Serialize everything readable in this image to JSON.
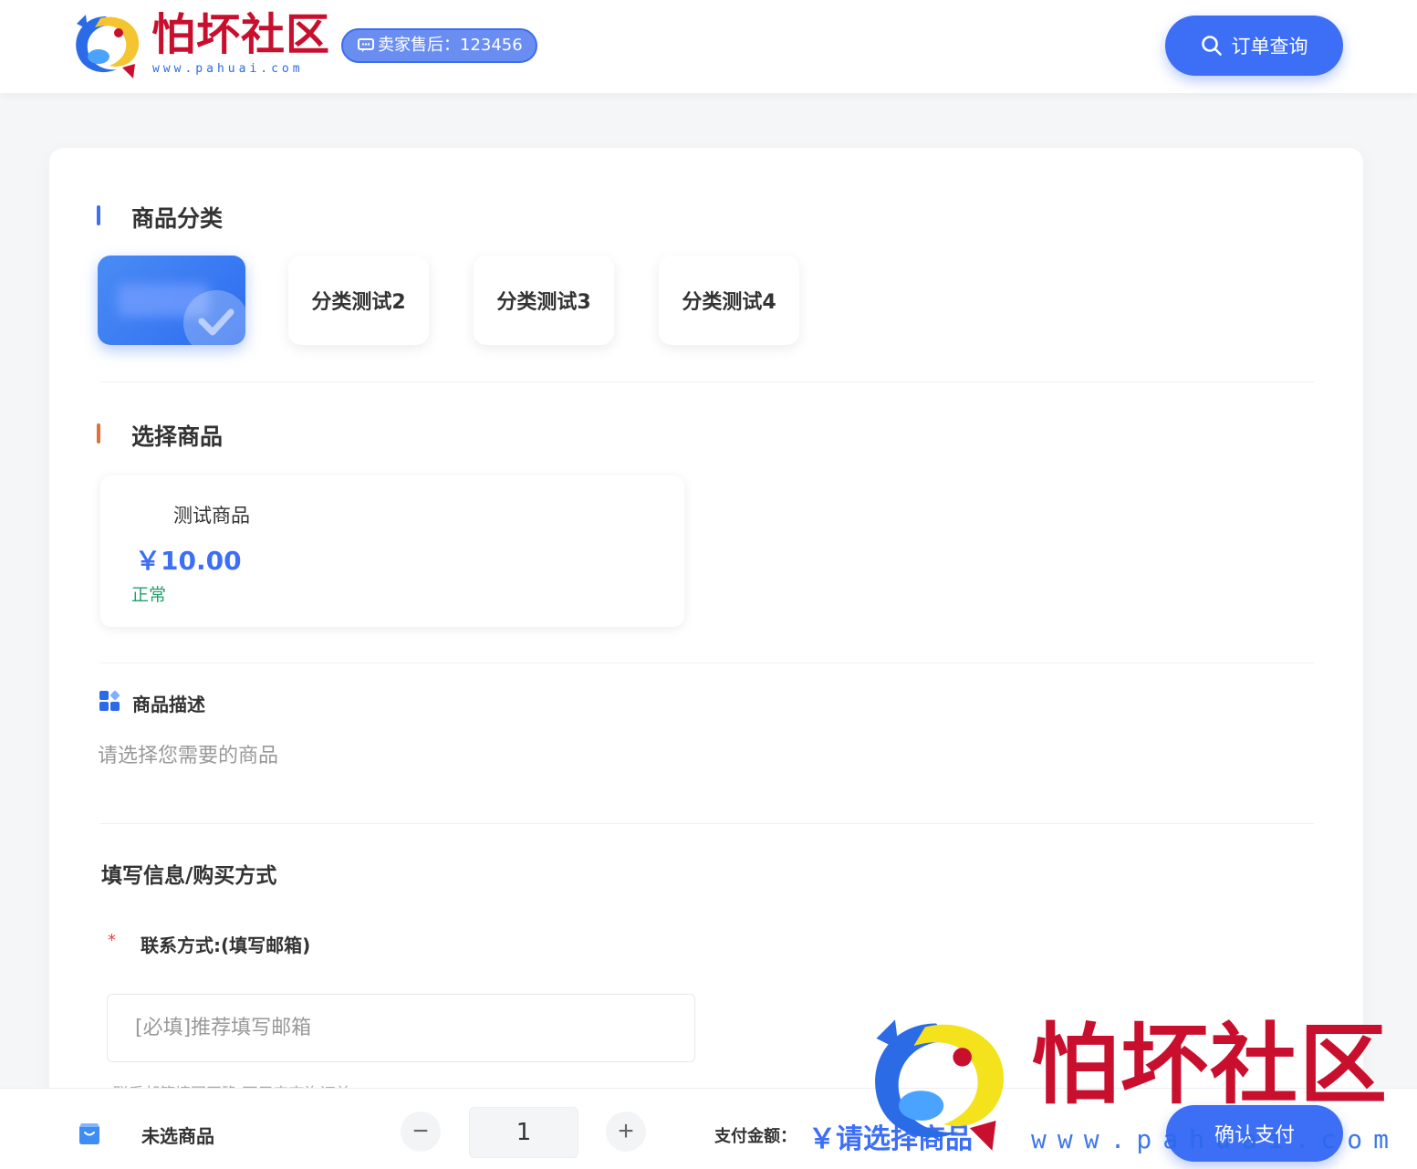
{
  "header": {
    "logo_text": "怕坏社区",
    "logo_url": "www.pahuai.com",
    "seller_badge": "卖家售后：123456",
    "order_query_label": "订单查询"
  },
  "categories": {
    "title": "商品分类",
    "items": [
      {
        "label": "",
        "active": true
      },
      {
        "label": "分类测试2",
        "active": false
      },
      {
        "label": "分类测试3",
        "active": false
      },
      {
        "label": "分类测试4",
        "active": false
      }
    ]
  },
  "products": {
    "title": "选择商品",
    "items": [
      {
        "name": "测试商品",
        "price": "￥10.00",
        "status": "正常"
      }
    ]
  },
  "description": {
    "title": "商品描述",
    "text": "请选择您需要的商品"
  },
  "form": {
    "title": "填写信息/购买方式",
    "contact_required": "*",
    "contact_label": "联系方式:(填写邮箱)",
    "contact_placeholder": "[必填]推荐填写邮箱",
    "hint": "联系邮箱填写正确 可用来查询订单"
  },
  "bottom_bar": {
    "selected_product": "未选商品",
    "minus": "−",
    "quantity": "1",
    "plus": "+",
    "pay_label": "支付金额：",
    "pay_amount": "￥请选择商品",
    "confirm_label": "确认支付"
  },
  "watermark": {
    "text": "怕坏社区",
    "url": "www.pahuai.com"
  },
  "colors": {
    "accent": "#3d6ef6",
    "brand_red": "#c8102e",
    "status_green": "#22a06b",
    "title_bar_blue": "#3d6ef6",
    "title_bar_orange": "#e0703a"
  }
}
